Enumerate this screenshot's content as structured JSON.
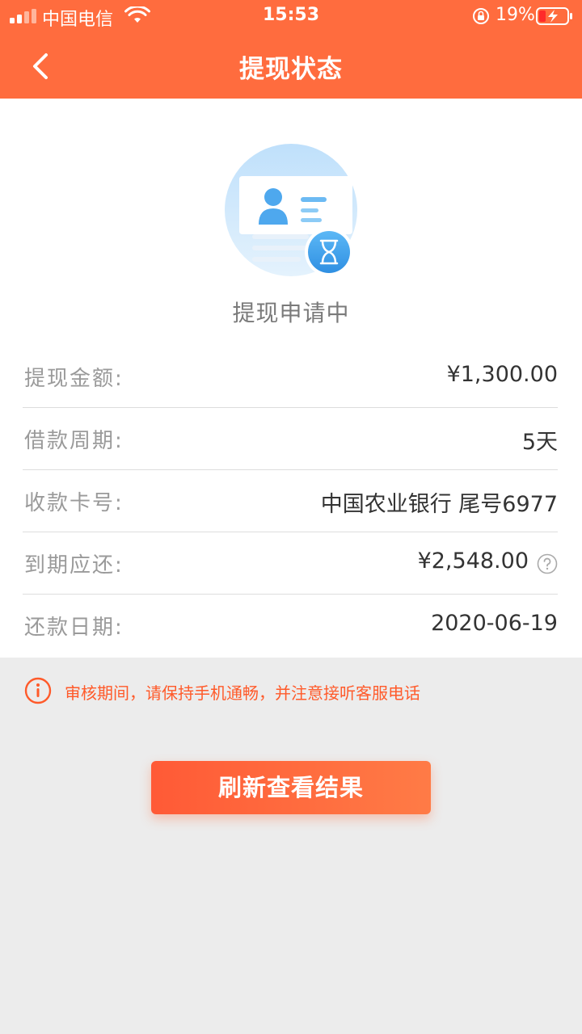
{
  "status_bar": {
    "carrier": "中国电信",
    "time": "15:53",
    "battery": "19%"
  },
  "header": {
    "title": "提现状态",
    "back_icon": "chevron-left-icon"
  },
  "status": {
    "icon": "id-card-hourglass-icon",
    "text": "提现申请中"
  },
  "details": [
    {
      "label": "提现金额:",
      "value": "¥1,300.00"
    },
    {
      "label": "借款周期:",
      "value": "5天"
    },
    {
      "label": "收款卡号:",
      "value": "中国农业银行 尾号6977"
    },
    {
      "label": "到期应还:",
      "value": "¥2,548.00",
      "icon": "question-circle-icon"
    },
    {
      "label": "还款日期:",
      "value": "2020-06-19"
    }
  ],
  "notice": {
    "icon": "info-circle-icon",
    "text": "审核期间，请保持手机通畅，并注意接听客服电话"
  },
  "actions": {
    "refresh_label": "刷新查看结果"
  },
  "colors": {
    "brand": "#ff6c3e",
    "notice": "#ff5a2a",
    "background": "#ececec"
  }
}
